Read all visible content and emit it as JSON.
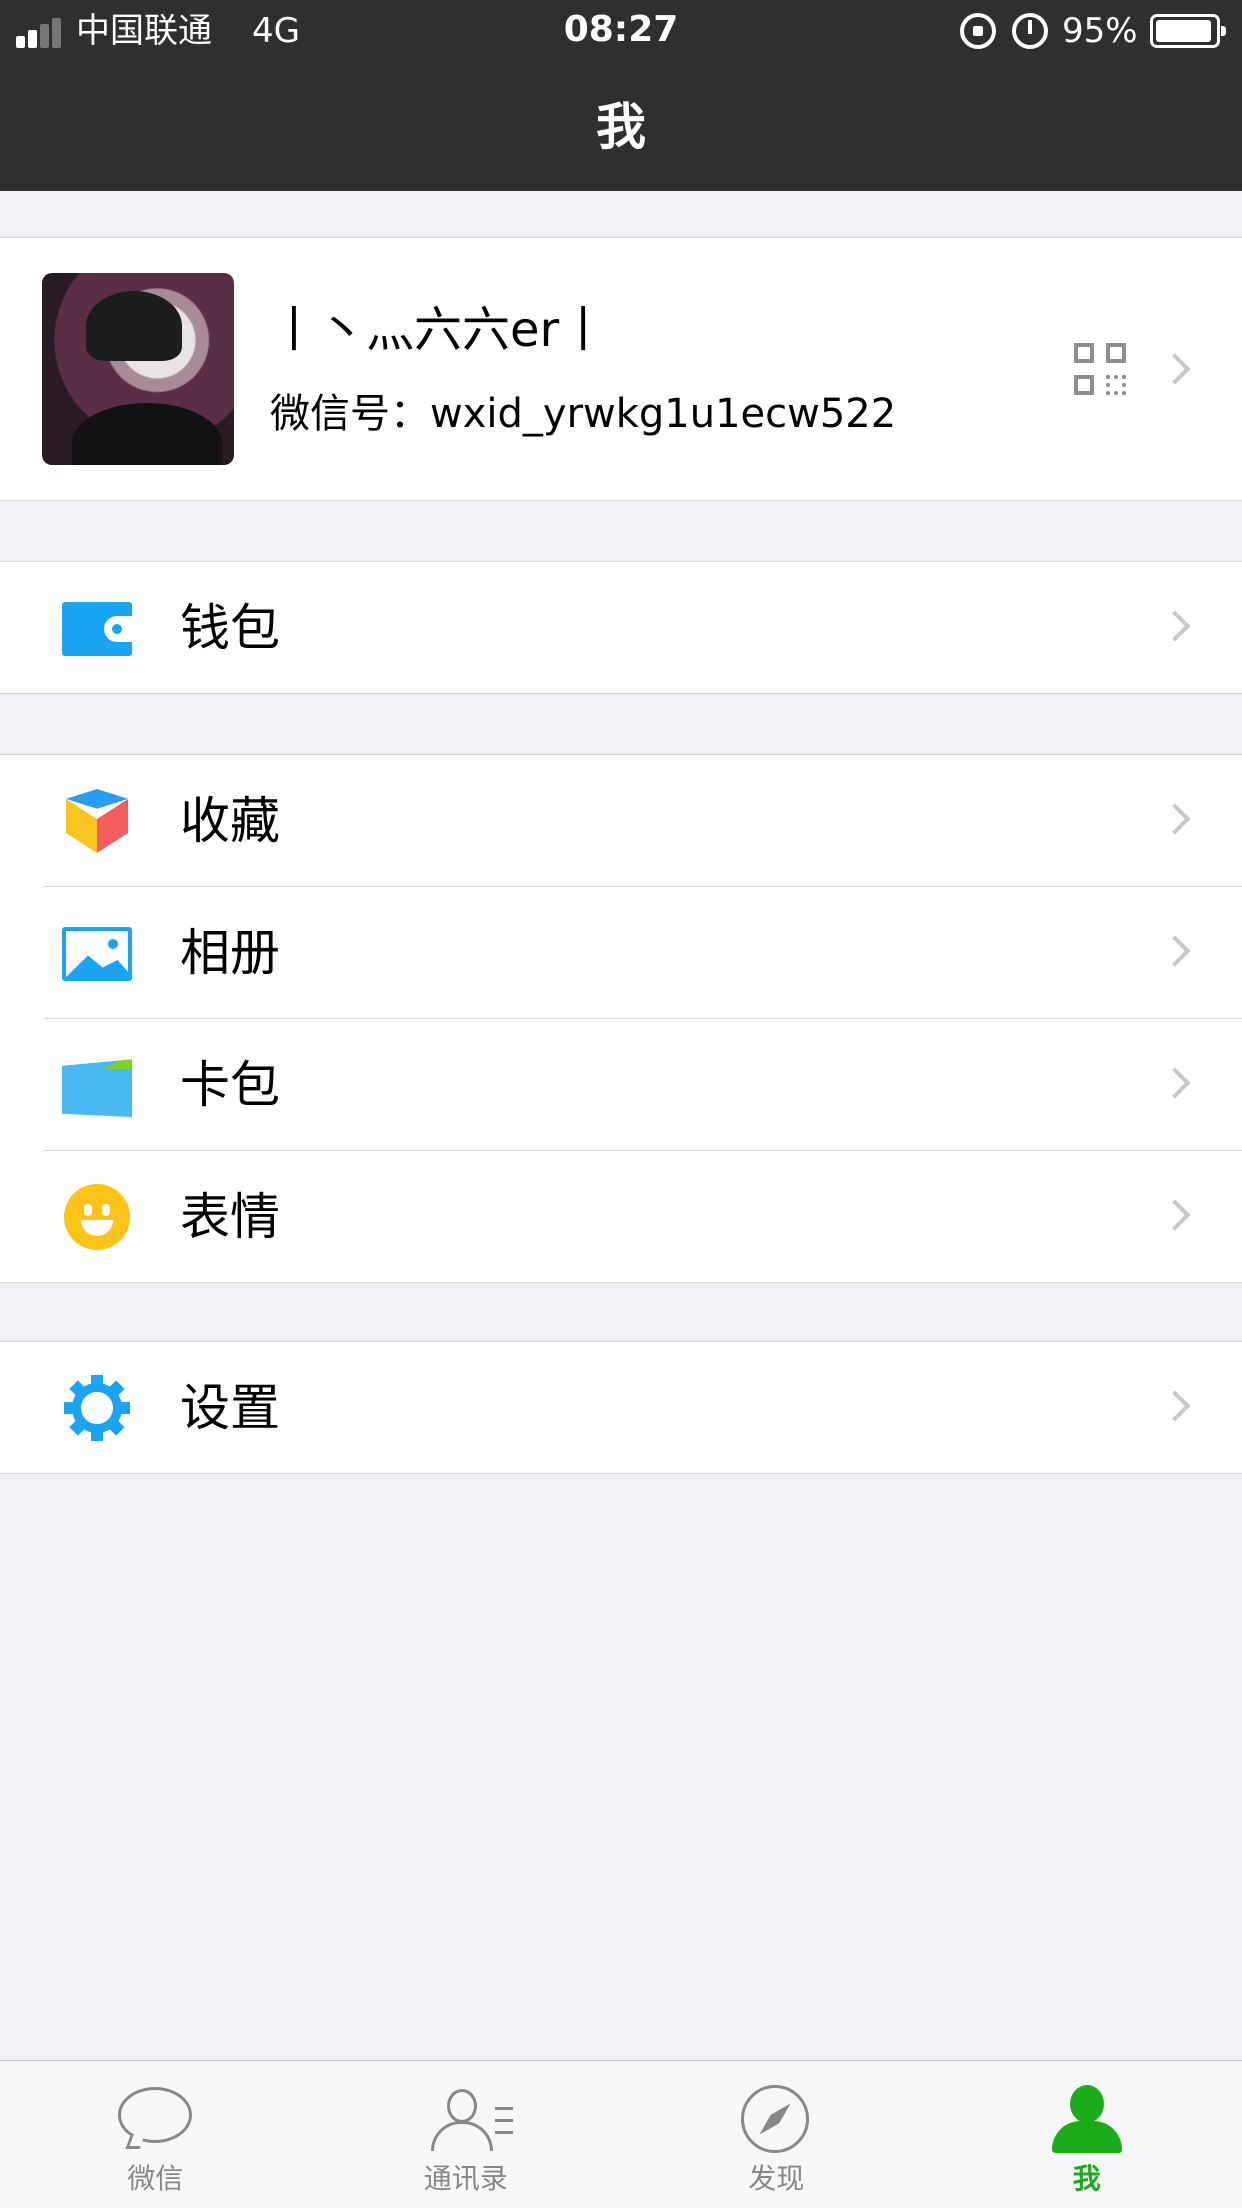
{
  "status_bar": {
    "carrier": "中国联通",
    "network": "4G",
    "time": "08:27",
    "battery_percent_label": "95%",
    "battery_level": 0.95
  },
  "nav": {
    "title": "我"
  },
  "profile": {
    "nickname": "丨丶灬六六er丨",
    "wechat_id_label": "微信号：",
    "wechat_id": "wxid_yrwkg1u1ecw522"
  },
  "menu": {
    "wallet": {
      "label": "钱包",
      "icon": "wallet-icon"
    },
    "favorites": {
      "label": "收藏",
      "icon": "cube-icon"
    },
    "album": {
      "label": "相册",
      "icon": "photo-icon"
    },
    "cards": {
      "label": "卡包",
      "icon": "card-icon"
    },
    "stickers": {
      "label": "表情",
      "icon": "smile-icon"
    },
    "settings": {
      "label": "设置",
      "icon": "gear-icon"
    }
  },
  "tabbar": {
    "tabs": [
      {
        "label": "微信",
        "icon": "chat-icon",
        "active": false
      },
      {
        "label": "通讯录",
        "icon": "contacts-icon",
        "active": false
      },
      {
        "label": "发现",
        "icon": "compass-icon",
        "active": false
      },
      {
        "label": "我",
        "icon": "me-icon",
        "active": true
      }
    ]
  },
  "colors": {
    "header_bg": "#2f2f32",
    "page_bg": "#efeff4",
    "accent_green": "#1aad19",
    "icon_blue": "#1aa5f4"
  }
}
